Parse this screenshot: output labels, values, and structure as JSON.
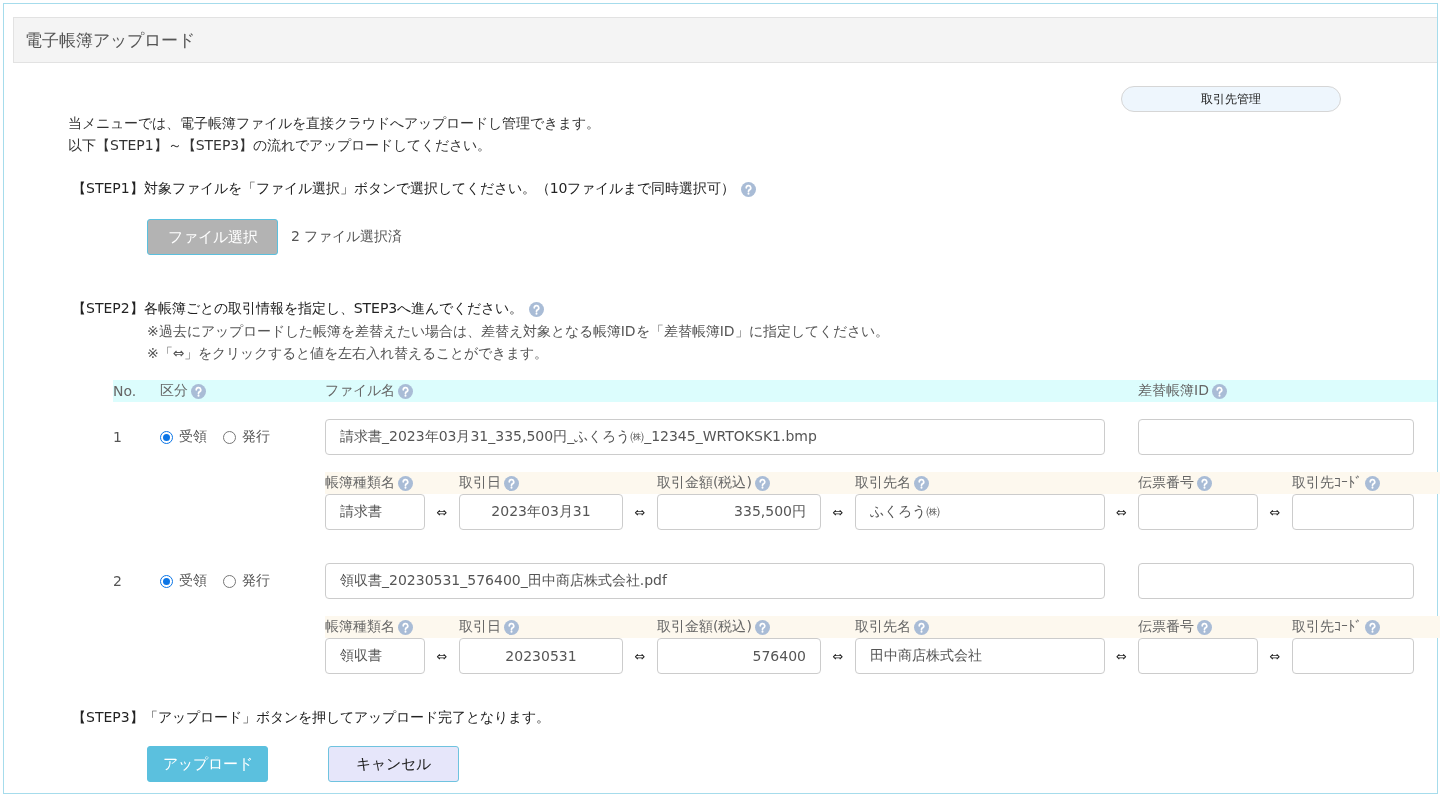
{
  "page_title": "電子帳簿アップロード",
  "partner_button": "取引先管理",
  "intro": [
    "当メニューでは、電子帳簿ファイルを直接クラウドへアップロードし管理できます。",
    "以下【STEP1】～【STEP3】の流れでアップロードしてください。"
  ],
  "step1": {
    "text": "【STEP1】対象ファイルを「ファイル選択」ボタンで選択してください。（10ファイルまで同時選択可）",
    "help": true,
    "file_button": "ファイル選択",
    "file_status": "2 ファイル選択済"
  },
  "step2": {
    "text": "【STEP2】各帳簿ごとの取引情報を指定し、STEP3へ進んでください。",
    "help": true,
    "notes": [
      "※過去にアップロードした帳簿を差替えたい場合は、差替え対象となる帳簿IDを「差替帳簿ID」に指定してください。",
      "※「⇔」をクリックすると値を左右入れ替えることができます。"
    ]
  },
  "table": {
    "columns": [
      {
        "label": "No.",
        "help": false
      },
      {
        "label": "区分",
        "help": true
      },
      {
        "label": "ファイル名",
        "help": true
      },
      {
        "label": "差替帳簿ID",
        "help": true
      }
    ],
    "rows": [
      {
        "no": "1",
        "options": [
          {
            "label": "受領",
            "selected": true
          },
          {
            "label": "発行",
            "selected": false
          }
        ],
        "file_name": "請求書_2023年03月31_335,500円_ふくろう㈱_12345_WRTOKSK1.bmp",
        "detail_columns": [
          {
            "label": "帳簿種類名",
            "help": true
          },
          {
            "label": "取引日",
            "help": true
          },
          {
            "label": "取引金額(税込)",
            "help": true
          },
          {
            "label": "取引先名",
            "help": true
          },
          {
            "label": "伝票番号",
            "help": true
          },
          {
            "label": "取引先ｺｰﾄﾞ",
            "help": true
          }
        ],
        "details": [
          "請求書",
          "2023年03月31",
          "335,500円",
          "ふくろう㈱"
        ],
        "swaps": [
          "⇔",
          "⇔",
          "⇔",
          "⇔",
          "⇔"
        ]
      },
      {
        "no": "2",
        "options": [
          {
            "label": "受領",
            "selected": true
          },
          {
            "label": "発行",
            "selected": false
          }
        ],
        "file_name": "領収書_20230531_576400_田中商店株式会社.pdf",
        "detail_columns": [
          {
            "label": "帳簿種類名",
            "help": true
          },
          {
            "label": "取引日",
            "help": true
          },
          {
            "label": "取引金額(税込)",
            "help": true
          },
          {
            "label": "取引先名",
            "help": true
          },
          {
            "label": "伝票番号",
            "help": true
          },
          {
            "label": "取引先ｺｰﾄﾞ",
            "help": true
          }
        ],
        "details": [
          "領収書",
          "20230531",
          "576400",
          "田中商店株式会社"
        ],
        "swaps": [
          "⇔",
          "⇔",
          "⇔",
          "⇔",
          "⇔"
        ]
      }
    ]
  },
  "step3": {
    "text": "【STEP3】「アップロード」ボタンを押してアップロード完了となります。"
  },
  "buttons": [
    {
      "label": "アップロード",
      "kind": "primary"
    },
    {
      "label": "キャンセル",
      "kind": "secondary"
    }
  ]
}
